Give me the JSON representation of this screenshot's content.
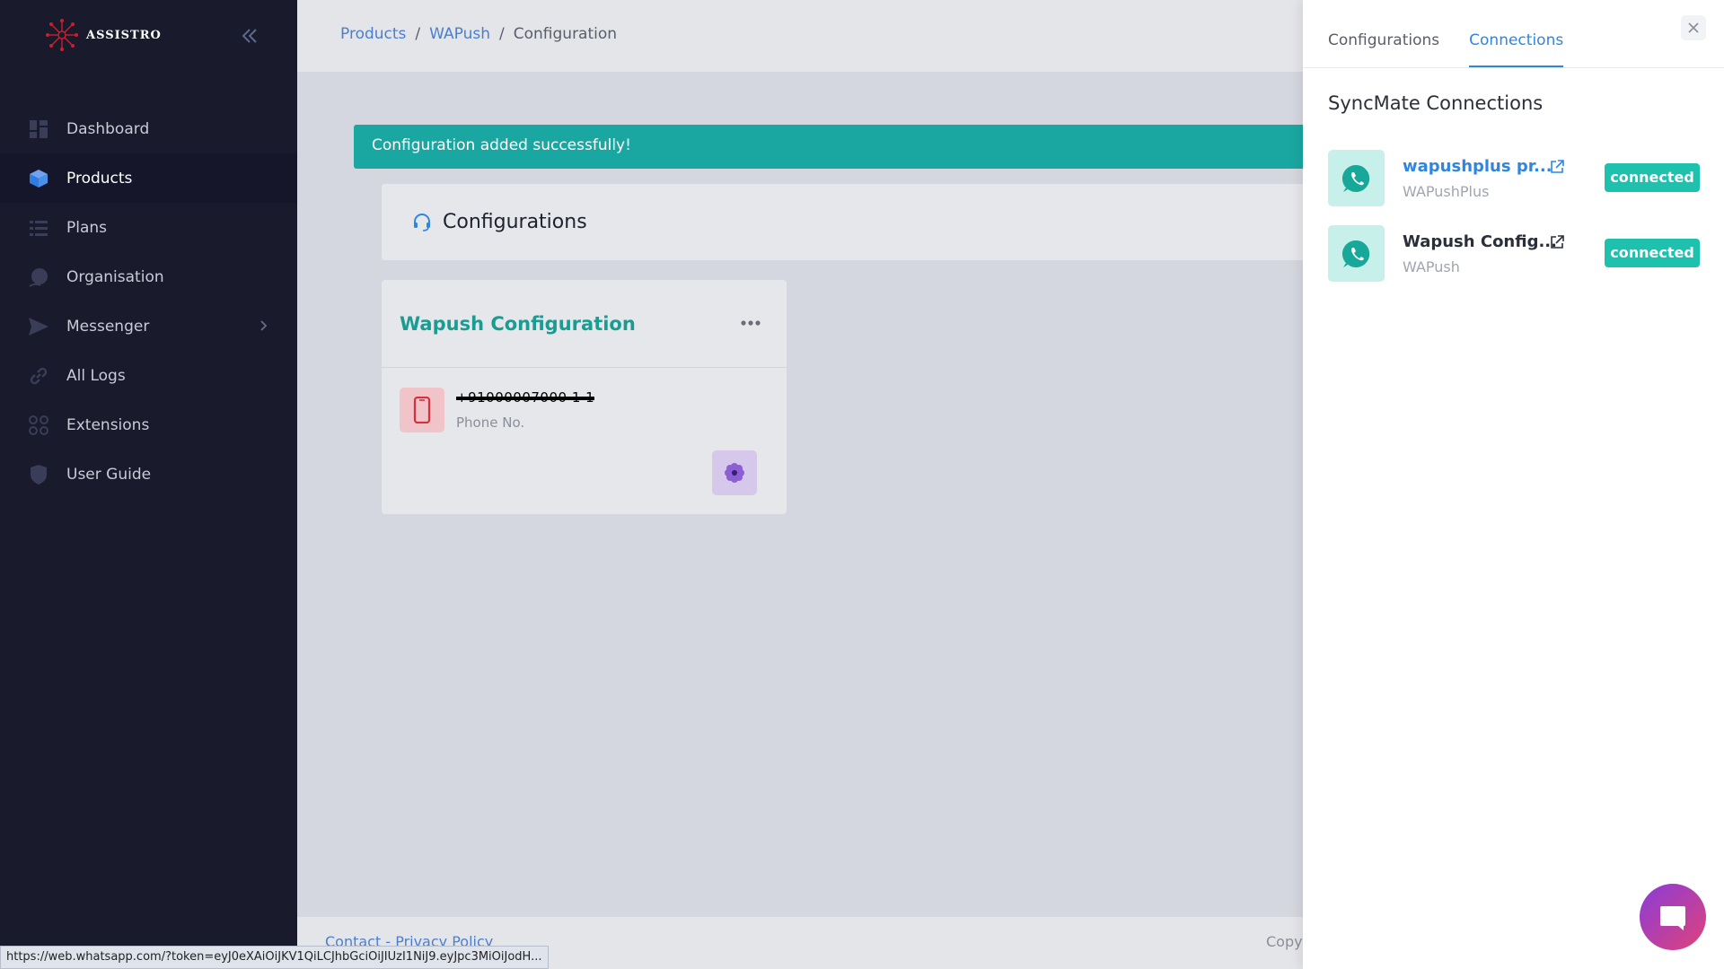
{
  "brand": {
    "name": "ASSISTRO"
  },
  "sidebar": {
    "items": [
      {
        "label": "Dashboard",
        "icon": "dashboard-icon"
      },
      {
        "label": "Products",
        "icon": "cube-icon",
        "active": true
      },
      {
        "label": "Plans",
        "icon": "list-icon"
      },
      {
        "label": "Organisation",
        "icon": "organisation-icon"
      },
      {
        "label": "Messenger",
        "icon": "send-icon",
        "has_submenu": true
      },
      {
        "label": "All Logs",
        "icon": "link-icon"
      },
      {
        "label": "Extensions",
        "icon": "extensions-icon"
      },
      {
        "label": "User Guide",
        "icon": "shield-icon"
      }
    ]
  },
  "breadcrumb": {
    "products": "Products",
    "wapush": "WAPush",
    "current": "Configuration",
    "sep": "/"
  },
  "alert": {
    "message": "Configuration added successfully!"
  },
  "configurations": {
    "title": "Configurations"
  },
  "card": {
    "title": "Wapush Configuration",
    "phone_value": "+91000007000 1 1",
    "phone_label": "Phone No."
  },
  "footer": {
    "links": "Contact - Privacy Policy",
    "copy": "Copy"
  },
  "status_url": "https://web.whatsapp.com/?token=eyJ0eXAiOiJKV1QiLCJhbGciOiJIUzI1NiJ9.eyJpc3MiOiJodH...",
  "panel": {
    "tabs": [
      {
        "label": "Configurations"
      },
      {
        "label": "Connections",
        "active": true
      }
    ],
    "title": "SyncMate Connections",
    "connections": [
      {
        "name": "wapushplus pr...",
        "sub": "WAPushPlus",
        "status": "connected"
      },
      {
        "name": "Wapush Config...",
        "sub": "WAPush",
        "status": "connected"
      }
    ]
  },
  "colors": {
    "accent": "#2f86e0",
    "teal": "#1aa7a1",
    "badge": "#1ec1ad",
    "sidebar": "#191a2c"
  }
}
